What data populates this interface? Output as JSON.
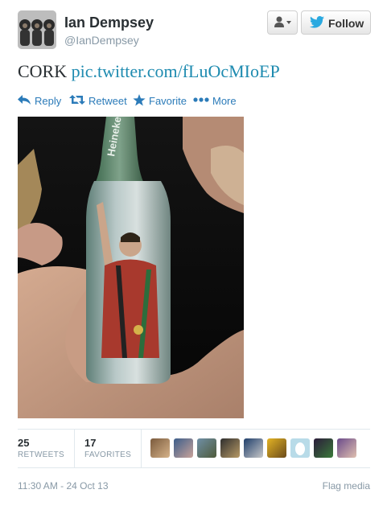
{
  "user": {
    "name": "Ian Dempsey",
    "handle": "@IanDempsey"
  },
  "header": {
    "follow_label": "Follow"
  },
  "tweet": {
    "text": "CORK",
    "link": "pic.twitter.com/fLuOcMIoEP"
  },
  "actions": {
    "reply": "Reply",
    "retweet": "Retweet",
    "favorite": "Favorite",
    "more": "More"
  },
  "stats": {
    "retweets_count": "25",
    "retweets_label": "RETWEETS",
    "favorites_count": "17",
    "favorites_label": "FAVORITES"
  },
  "footer": {
    "timestamp": "11:30 AM - 24 Oct 13",
    "flag": "Flag media"
  },
  "icons": {
    "user_menu": "person-dropdown-icon",
    "follow": "bird-icon",
    "reply": "reply-arrow-icon",
    "retweet": "retweet-icon",
    "favorite": "star-icon",
    "more": "dots-icon"
  },
  "colors": {
    "link": "#2b7bb9",
    "muted": "#8899a6"
  }
}
